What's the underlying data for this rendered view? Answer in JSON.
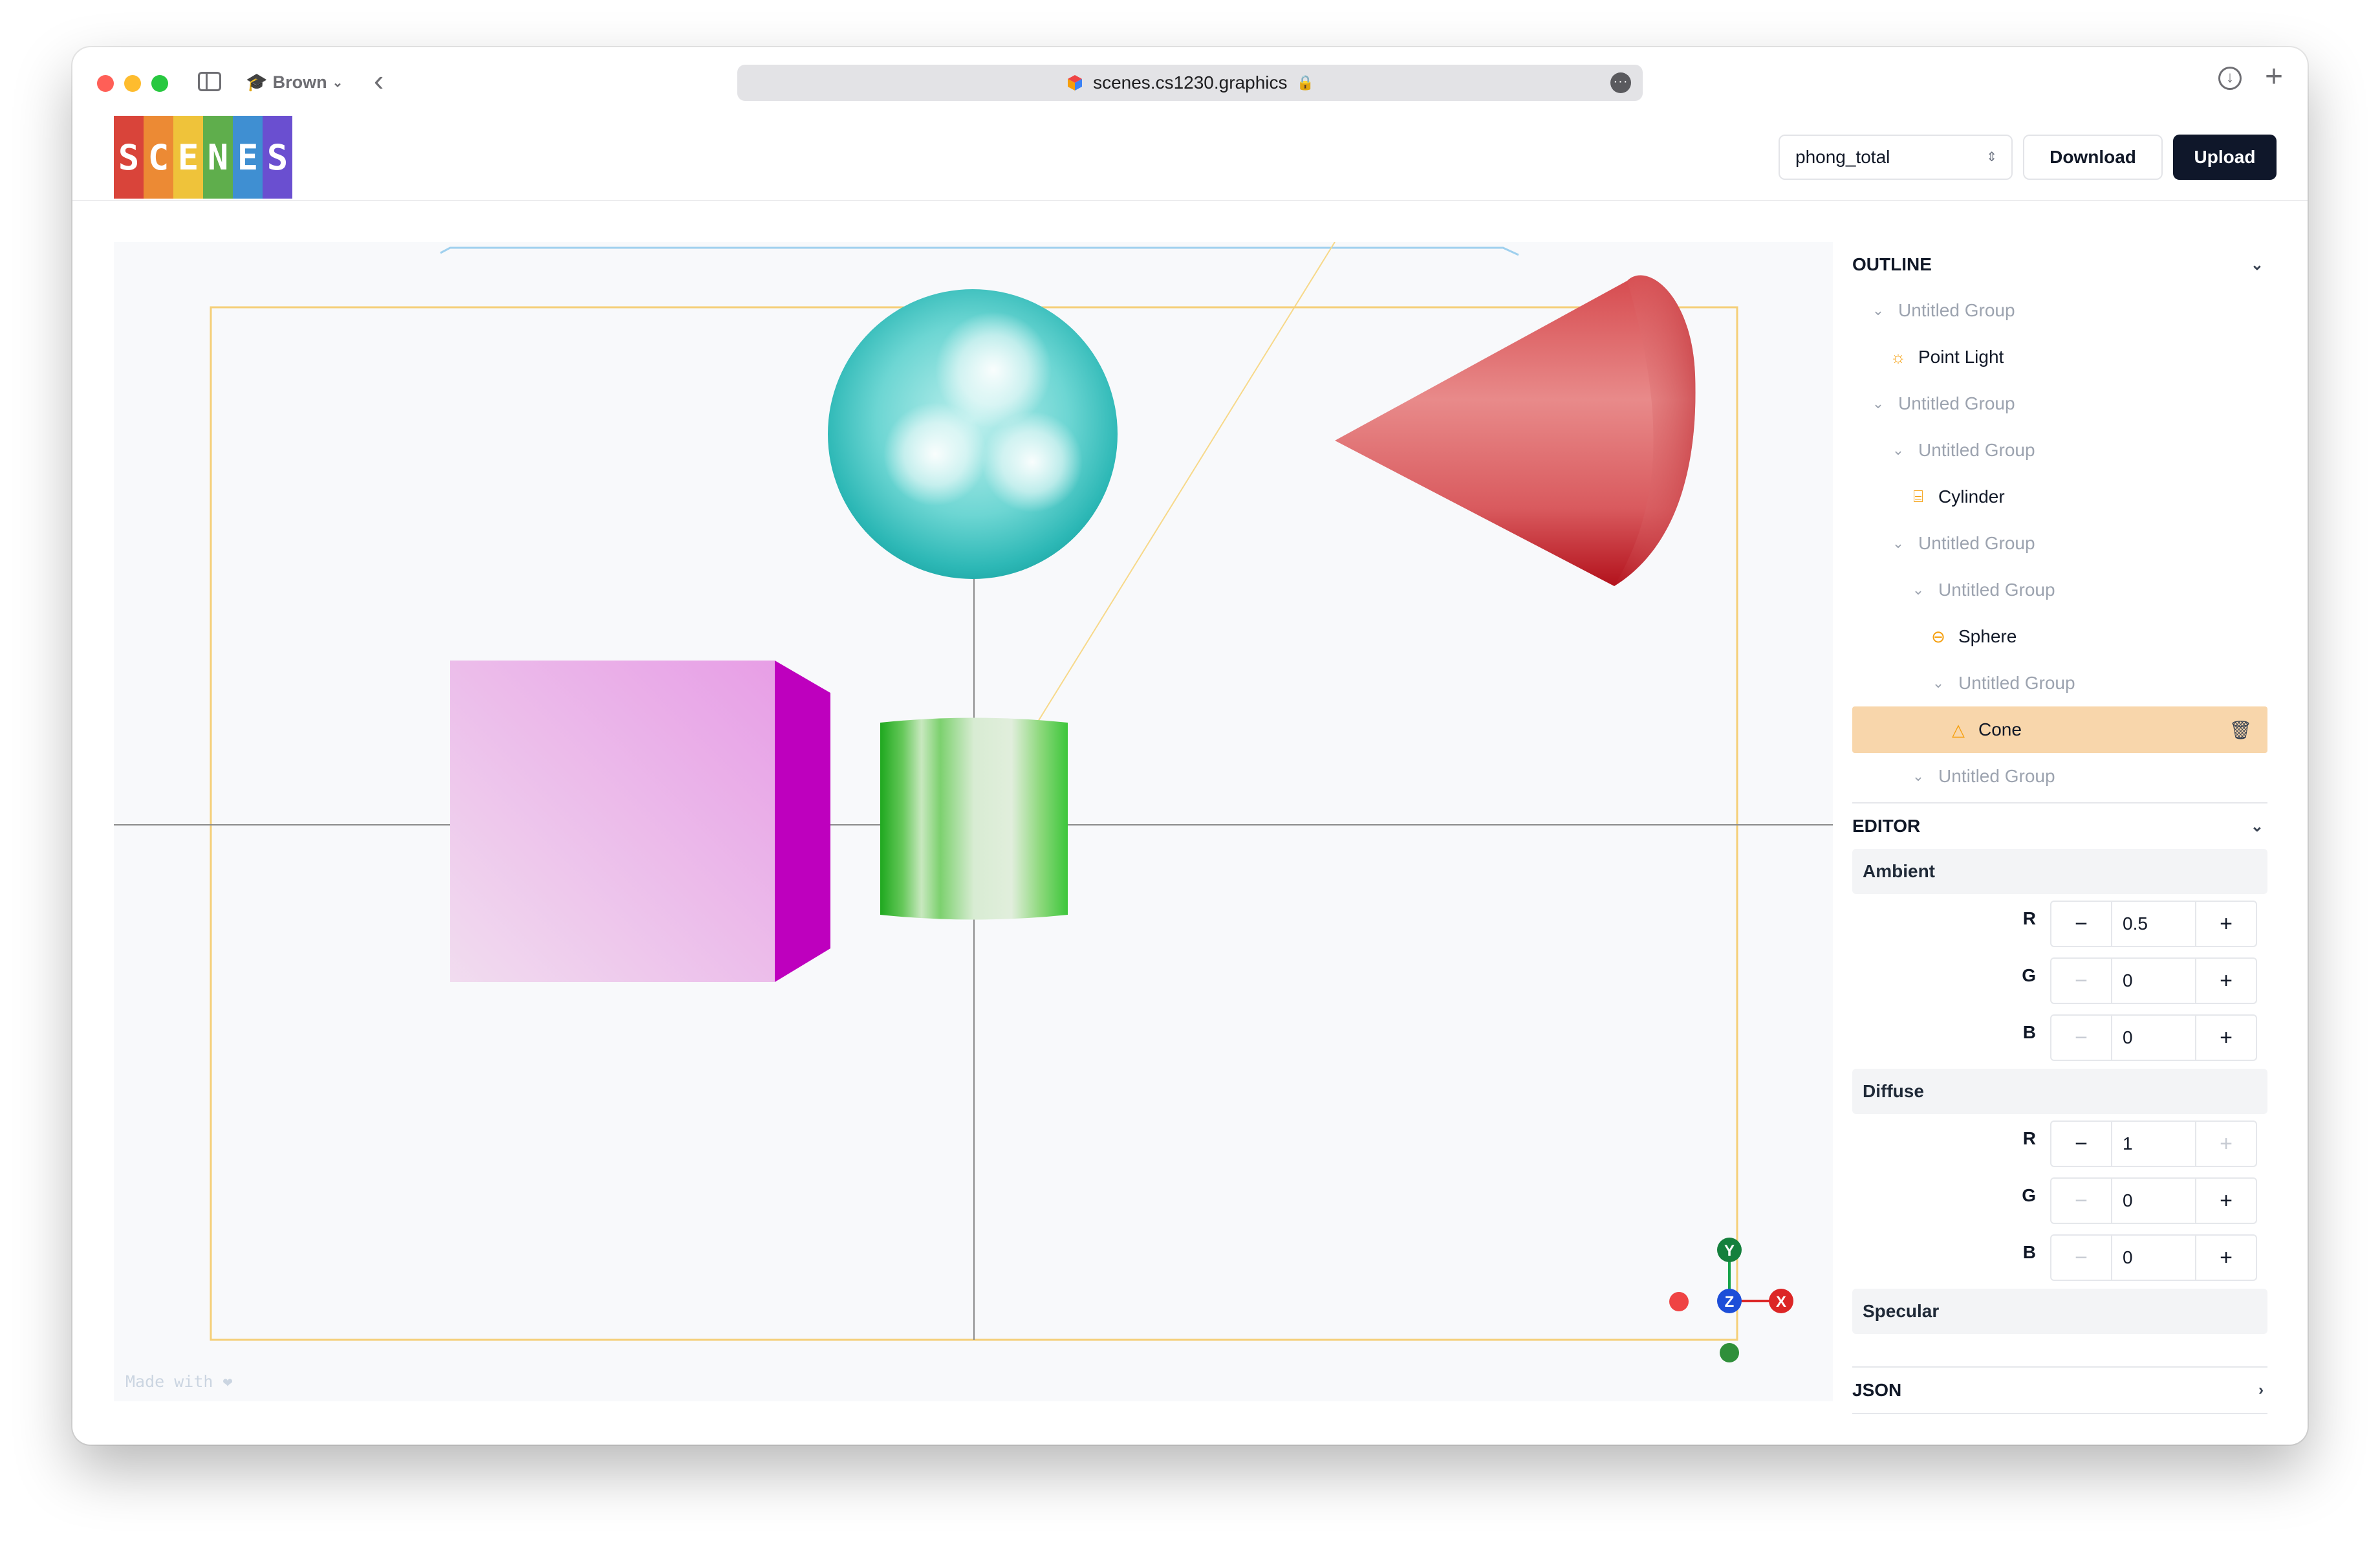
{
  "browser": {
    "profile_name": "Brown",
    "url": "scenes.cs1230.graphics"
  },
  "app": {
    "logo_letters": [
      "S",
      "C",
      "E",
      "N",
      "E",
      "S"
    ],
    "logo_colors": [
      "#d9443a",
      "#ec8a34",
      "#efc33a",
      "#5fae4c",
      "#3f8fd2",
      "#6a4fd0"
    ],
    "scene_select_value": "phong_total",
    "download_label": "Download",
    "upload_label": "Upload"
  },
  "viewport": {
    "made_with": "Made with ❤",
    "gizmo": {
      "y": "Y",
      "z": "Z",
      "x": "X"
    }
  },
  "outline": {
    "title": "OUTLINE",
    "items": [
      {
        "label": "Untitled Group",
        "kind": "group",
        "depth": 1
      },
      {
        "label": "Point Light",
        "kind": "light",
        "depth": 2
      },
      {
        "label": "Untitled Group",
        "kind": "group",
        "depth": 1
      },
      {
        "label": "Untitled Group",
        "kind": "group",
        "depth": 2
      },
      {
        "label": "Cylinder",
        "kind": "cylinder",
        "depth": 3
      },
      {
        "label": "Untitled Group",
        "kind": "group",
        "depth": 2
      },
      {
        "label": "Untitled Group",
        "kind": "group",
        "depth": 3
      },
      {
        "label": "Sphere",
        "kind": "sphere",
        "depth": 4
      },
      {
        "label": "Untitled Group",
        "kind": "group",
        "depth": 4
      },
      {
        "label": "Cone",
        "kind": "cone",
        "depth": 5,
        "selected": true
      },
      {
        "label": "Untitled Group",
        "kind": "group",
        "depth": 3
      }
    ]
  },
  "editor": {
    "title": "EDITOR",
    "ambient": {
      "label": "Ambient",
      "r": "0.5",
      "g": "0",
      "b": "0"
    },
    "diffuse": {
      "label": "Diffuse",
      "r": "1",
      "g": "0",
      "b": "0"
    },
    "specular": {
      "label": "Specular"
    },
    "channel_labels": {
      "r": "R",
      "g": "G",
      "b": "B"
    }
  },
  "json_section": {
    "title": "JSON"
  }
}
